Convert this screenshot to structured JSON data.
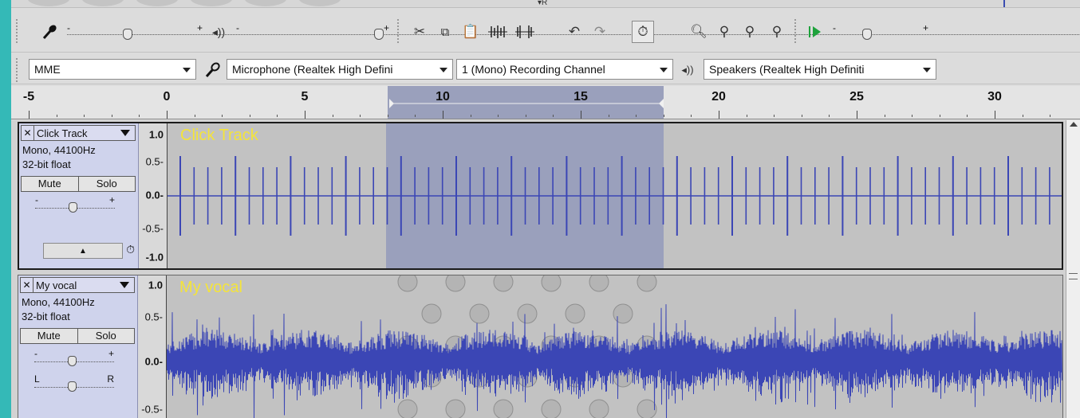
{
  "top_strip": {
    "marker": "▾R"
  },
  "meter_toolbar": {
    "mic_icon": "microphone-icon",
    "rec_slider": {
      "minus": "-",
      "plus": "+",
      "level": 0.45
    },
    "speaker_icon": "speaker-icon",
    "play_slider": {
      "minus": "-",
      "plus": "+",
      "level": 0.97
    },
    "edit_tools": [
      "cut-icon",
      "copy-icon",
      "paste-icon",
      "trim-audio-icon",
      "silence-audio-icon"
    ],
    "undo_icon": "undo-icon",
    "redo_icon": "redo-icon",
    "sync_lock_icon": "sync-lock-icon",
    "zoom_tools": [
      "zoom-in-icon",
      "zoom-out-icon",
      "fit-selection-icon",
      "fit-project-icon"
    ],
    "play_at_speed_icon": "play-at-speed-icon",
    "speed_slider": {
      "minus": "-",
      "plus": "+",
      "level": 0.35
    }
  },
  "device_toolbar": {
    "host": "MME",
    "input_device": "Microphone (Realtek High Defini",
    "channels": "1 (Mono) Recording Channel",
    "output_device": "Speakers (Realtek High Definiti"
  },
  "ruler": {
    "labels": [
      "-5",
      "0",
      "5",
      "10",
      "15",
      "20",
      "25",
      "30"
    ],
    "selection_start": 8,
    "selection_end": 18
  },
  "tracks": [
    {
      "name": "Click Track",
      "format": "Mono, 44100Hz",
      "bit_depth": "32-bit float",
      "mute_label": "Mute",
      "solo_label": "Solo",
      "gain": {
        "minus": "-",
        "plus": "+"
      },
      "scale": [
        "1.0",
        "0.5-",
        "0.0-",
        "-0.5-",
        "-1.0"
      ],
      "display_name": "Click Track"
    },
    {
      "name": "My vocal",
      "format": "Mono, 44100Hz",
      "bit_depth": "32-bit float",
      "mute_label": "Mute",
      "solo_label": "Solo",
      "gain": {
        "minus": "-",
        "plus": "+"
      },
      "pan": {
        "left": "L",
        "right": "R"
      },
      "scale": [
        "1.0",
        "0.5-",
        "0.0-",
        "-0.5-"
      ],
      "display_name": "My vocal"
    }
  ],
  "colors": {
    "background_accent": "#34b9b7",
    "waveform": "#3b46b5",
    "selection": "#9aa0bc",
    "track_name": "#f4e43a"
  }
}
